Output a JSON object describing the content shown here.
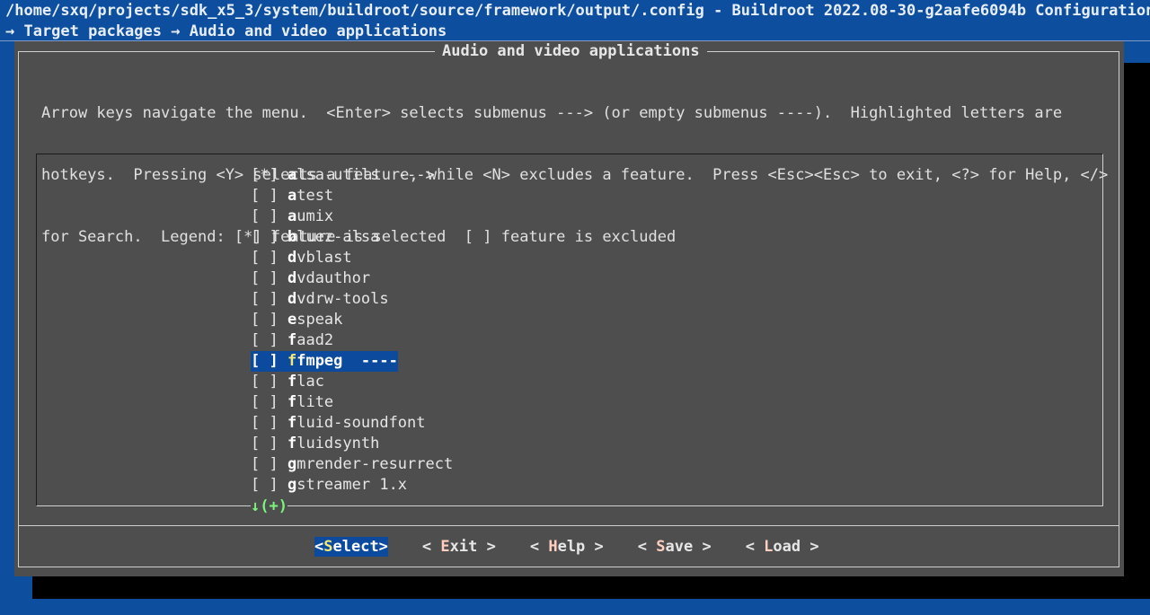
{
  "header": {
    "title": "/home/sxq/projects/sdk_x5_3/system/buildroot/source/framework/output/.config - Buildroot 2022.08-30-g2aafe6094b Configuration",
    "breadcrumb": "→ Target packages → Audio and video applications"
  },
  "dialog": {
    "title": "Audio and video applications",
    "help_lines": [
      "Arrow keys navigate the menu.  <Enter> selects submenus ---> (or empty submenus ----).  Highlighted letters are",
      "hotkeys.  Pressing <Y> selects a feature, while <N> excludes a feature.  Press <Esc><Esc> to exit, <?> for Help, </>",
      "for Search.  Legend: [*] feature is selected  [ ] feature is excluded"
    ]
  },
  "menu": {
    "items": [
      {
        "check": "[*]",
        "hot": "a",
        "rest": "lsa-utils",
        "suffix": "  --->",
        "selected": false
      },
      {
        "check": "[ ]",
        "hot": "a",
        "rest": "test",
        "suffix": "",
        "selected": false
      },
      {
        "check": "[ ]",
        "hot": "a",
        "rest": "umix",
        "suffix": "",
        "selected": false
      },
      {
        "check": "[ ]",
        "hot": "b",
        "rest": "luez-alsa",
        "suffix": "",
        "selected": false
      },
      {
        "check": "[ ]",
        "hot": "d",
        "rest": "vblast",
        "suffix": "",
        "selected": false
      },
      {
        "check": "[ ]",
        "hot": "d",
        "rest": "vdauthor",
        "suffix": "",
        "selected": false
      },
      {
        "check": "[ ]",
        "hot": "d",
        "rest": "vdrw-tools",
        "suffix": "",
        "selected": false
      },
      {
        "check": "[ ]",
        "hot": "e",
        "rest": "speak",
        "suffix": "",
        "selected": false
      },
      {
        "check": "[ ]",
        "hot": "f",
        "rest": "aad2",
        "suffix": "",
        "selected": false
      },
      {
        "check": "[ ]",
        "hot": "f",
        "rest": "fmpeg",
        "suffix": "  ----",
        "selected": true
      },
      {
        "check": "[ ]",
        "hot": "f",
        "rest": "lac",
        "suffix": "",
        "selected": false
      },
      {
        "check": "[ ]",
        "hot": "f",
        "rest": "lite",
        "suffix": "",
        "selected": false
      },
      {
        "check": "[ ]",
        "hot": "f",
        "rest": "luid-soundfont",
        "suffix": "",
        "selected": false
      },
      {
        "check": "[ ]",
        "hot": "f",
        "rest": "luidsynth",
        "suffix": "",
        "selected": false
      },
      {
        "check": "[ ]",
        "hot": "g",
        "rest": "mrender-resurrect",
        "suffix": "",
        "selected": false
      },
      {
        "check": "[ ]",
        "hot": "g",
        "rest": "streamer 1.x",
        "suffix": "",
        "selected": false
      }
    ],
    "more_indicator": "↓(+)"
  },
  "buttons": [
    {
      "pre": "<",
      "hk": "S",
      "post": "elect>",
      "active": true
    },
    {
      "pre": "< ",
      "hk": "E",
      "post": "xit >",
      "active": false
    },
    {
      "pre": "< ",
      "hk": "H",
      "post": "elp >",
      "active": false
    },
    {
      "pre": "< ",
      "hk": "S",
      "post": "ave >",
      "active": false
    },
    {
      "pre": "< ",
      "hk": "L",
      "post": "oad >",
      "active": false
    }
  ],
  "colors": {
    "background": "#0d4f9e",
    "dialog": "#4e4e4e",
    "highlight": "#0b4a9c",
    "more_indicator": "#7cf57c"
  }
}
